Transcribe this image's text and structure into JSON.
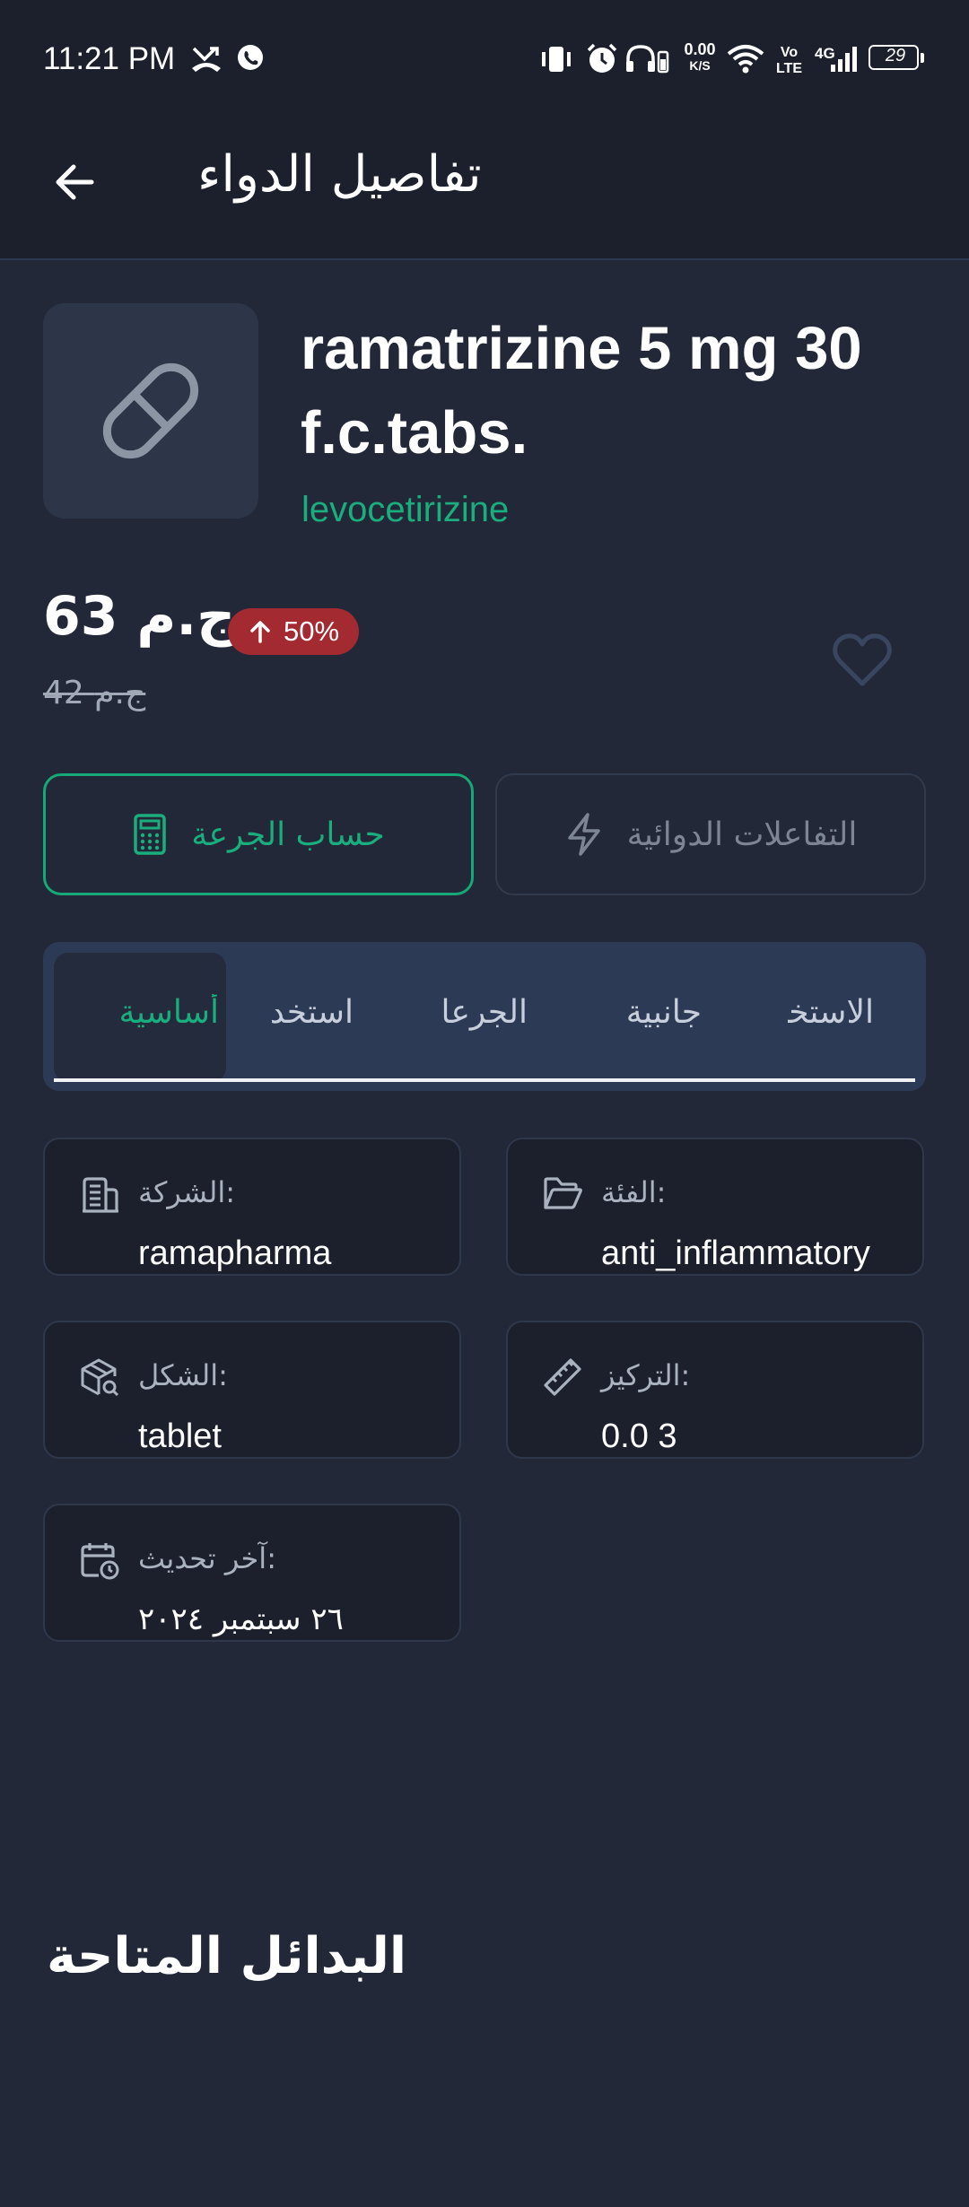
{
  "status_bar": {
    "time": "11:21 PM",
    "net_speed_value": "0.00",
    "net_speed_unit": "K/S",
    "volte_top": "Vo",
    "volte_bottom": "LTE",
    "network": "4G",
    "battery": "29"
  },
  "app_bar": {
    "title": "تفاصيل الدواء"
  },
  "product": {
    "name": "ramatrizine 5 mg 30 f.c.tabs.",
    "generic_name": "levocetirizine",
    "price_current": "63 ج.م",
    "price_old": "42 ج.م",
    "price_change": "50%"
  },
  "actions": {
    "dose_calculator": "حساب الجرعة",
    "drug_interactions": "التفاعلات الدوائية"
  },
  "tabs": [
    {
      "label": "أساسية"
    },
    {
      "label": "استخدامات"
    },
    {
      "label": "الجرعات"
    },
    {
      "label": "جانبية"
    },
    {
      "label": "الاستخدام"
    }
  ],
  "info": {
    "company_label": ":الشركة",
    "company_value": "ramapharma",
    "category_label": ":الفئة",
    "category_value": "anti_inflammatory",
    "form_label": ":الشكل",
    "form_value": "tablet",
    "concentration_label": ":التركيز",
    "concentration_value": "0.0 3",
    "updated_label": ":آخر تحديث",
    "updated_value": "٢٦ سبتمبر ٢٠٢٤"
  },
  "alternatives": {
    "title": "البدائل المتاحة"
  },
  "colors": {
    "background": "#222838",
    "bar": "#1b202c",
    "accent_green": "#1aad7d",
    "badge_red": "#a32a30",
    "tabs_bg": "#2d3a55"
  },
  "icons": [
    "arrow-left-icon",
    "pill-icon",
    "arrow-up-icon",
    "heart-icon",
    "calculator-icon",
    "lightning-icon",
    "building-icon",
    "folder-icon",
    "package-search-icon",
    "ruler-icon",
    "calendar-clock-icon"
  ]
}
